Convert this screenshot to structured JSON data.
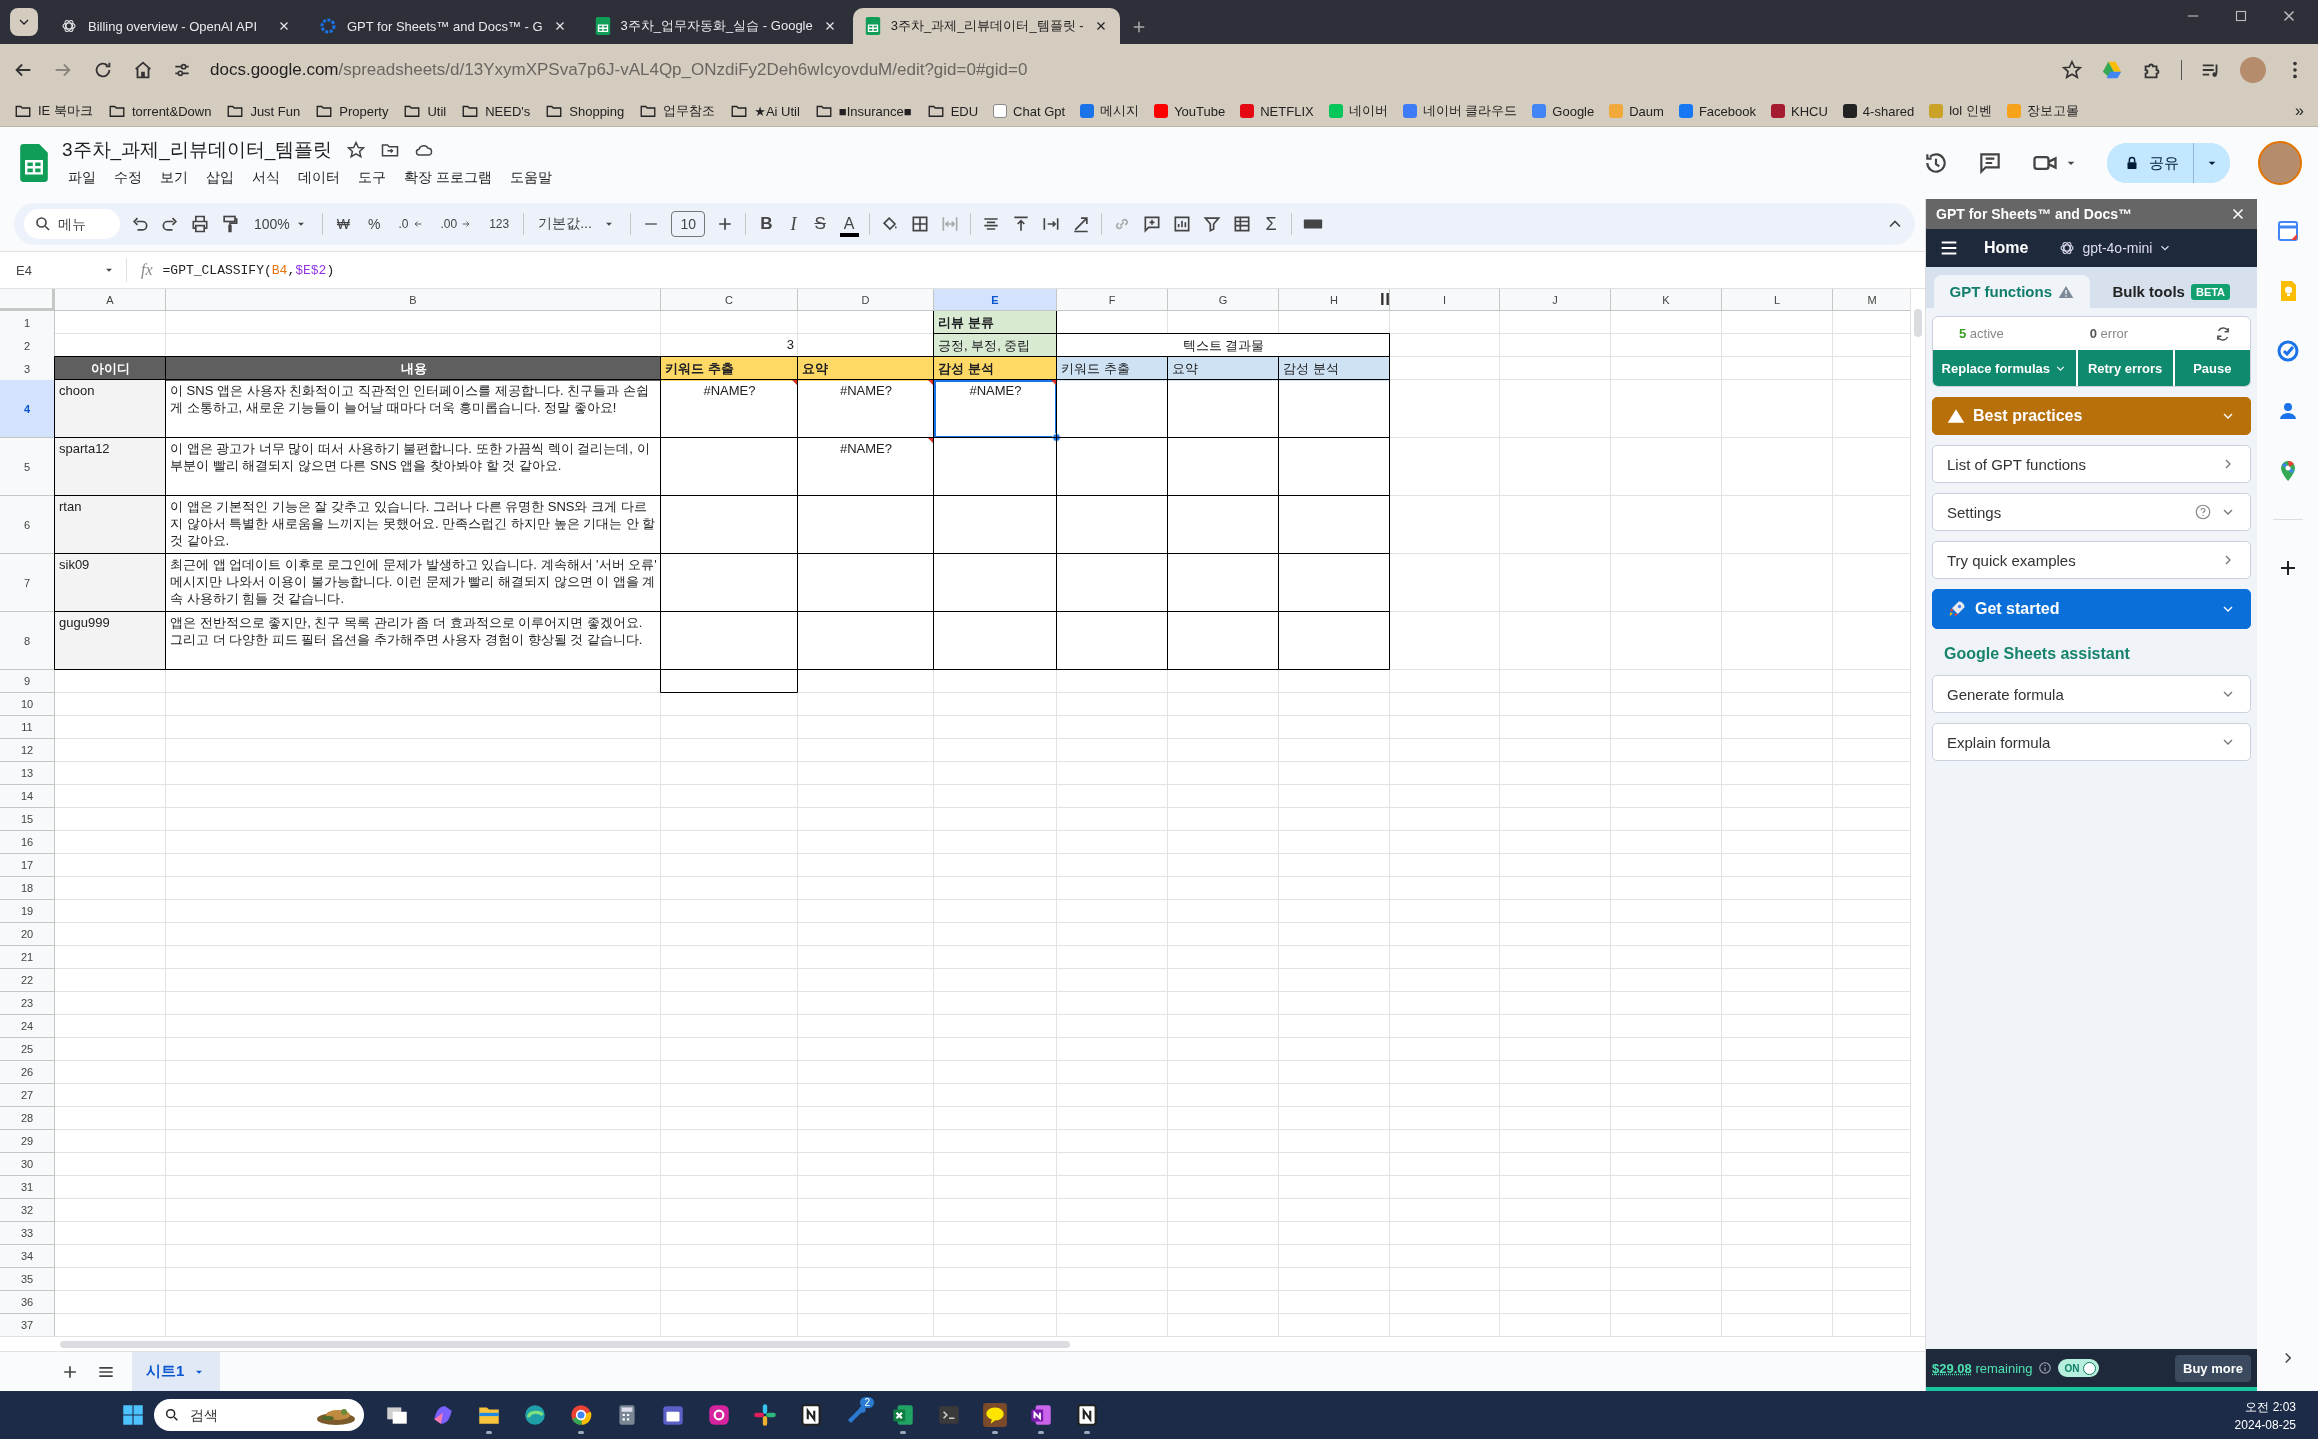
{
  "browser": {
    "tabs": [
      {
        "title": "Billing overview - OpenAI API",
        "kind": "openai",
        "selected": false
      },
      {
        "title": "GPT for Sheets™ and Docs™ - G",
        "kind": "ring",
        "selected": false
      },
      {
        "title": "3주차_업무자동화_실습 - Google",
        "kind": "sheets",
        "selected": false
      },
      {
        "title": "3주차_과제_리뷰데이터_템플릿 -",
        "kind": "sheets",
        "selected": true
      }
    ],
    "address": {
      "domain": "docs.google.com",
      "path": "/spreadsheets/d/13YxymXPSva7p6J-vAL4Qp_ONzdiFy2Deh6wIcyovduM/edit?gid=0#gid=0"
    },
    "bookmarks": [
      {
        "label": "IE 북마크",
        "kind": "folder"
      },
      {
        "label": "torrent&Down",
        "kind": "folder"
      },
      {
        "label": "Just Fun",
        "kind": "folder"
      },
      {
        "label": "Property",
        "kind": "folder"
      },
      {
        "label": "Util",
        "kind": "folder"
      },
      {
        "label": "NEED's",
        "kind": "folder"
      },
      {
        "label": "Shopping",
        "kind": "folder"
      },
      {
        "label": "업무참조",
        "kind": "folder"
      },
      {
        "label": "★Ai Util",
        "kind": "folder"
      },
      {
        "label": "■Insurance■",
        "kind": "folder"
      },
      {
        "label": "EDU",
        "kind": "folder"
      },
      {
        "label": "Chat Gpt",
        "kind": "site",
        "color": "#ffffff"
      },
      {
        "label": "메시지",
        "kind": "site",
        "color": "#1a73e8"
      },
      {
        "label": "YouTube",
        "kind": "site",
        "color": "#ff0000"
      },
      {
        "label": "NETFLIX",
        "kind": "site",
        "color": "#e50914"
      },
      {
        "label": "네이버",
        "kind": "site",
        "color": "#03c75a"
      },
      {
        "label": "네이버 클라우드",
        "kind": "site",
        "color": "#3d7bf7"
      },
      {
        "label": "Google",
        "kind": "site",
        "color": "#4285f4"
      },
      {
        "label": "Daum",
        "kind": "site",
        "color": "#f2a93b"
      },
      {
        "label": "Facebook",
        "kind": "site",
        "color": "#1877f2"
      },
      {
        "label": "KHCU",
        "kind": "site",
        "color": "#a51c30"
      },
      {
        "label": "4-shared",
        "kind": "site",
        "color": "#222222"
      },
      {
        "label": "lol 인벤",
        "kind": "site",
        "color": "#c9a227"
      },
      {
        "label": "장보고몰",
        "kind": "site",
        "color": "#f7a21b"
      }
    ],
    "more_bookmarks": "»"
  },
  "document": {
    "title": "3주차_과제_리뷰데이터_템플릿",
    "menu": [
      "파일",
      "수정",
      "보기",
      "삽입",
      "서식",
      "데이터",
      "도구",
      "확장 프로그램",
      "도움말"
    ],
    "share": "공유"
  },
  "toolbar": {
    "search_placeholder": "메뉴",
    "zoom": "100%",
    "number_formats": [
      {
        "label": "₩",
        "kind": "plain"
      },
      {
        "label": "%",
        "kind": "plain"
      },
      {
        "label": ".0",
        "kind": "decrease"
      },
      {
        "label": ".00",
        "kind": "increase"
      },
      {
        "label": "123",
        "kind": "plain"
      }
    ],
    "font": "기본값...",
    "font_size": "10",
    "text_styles": [
      {
        "label": "B",
        "kind": "bold"
      },
      {
        "label": "I",
        "kind": "italic"
      },
      {
        "label": "S",
        "kind": "strike"
      },
      {
        "label": "A",
        "kind": "color"
      }
    ],
    "functions": "Σ"
  },
  "formula_bar": {
    "name_box": "E4",
    "fx": "fx",
    "formula": [
      {
        "text": "=GPT_CLASSIFY("
      },
      {
        "text": "B4",
        "color": "#e8710a"
      },
      {
        "text": ","
      },
      {
        "text": "$E$2",
        "color": "#9334e6"
      },
      {
        "text": ")"
      }
    ]
  },
  "sheet": {
    "columns": [
      {
        "label": "A",
        "selected": false
      },
      {
        "label": "B",
        "selected": false
      },
      {
        "label": "C",
        "selected": false
      },
      {
        "label": "D",
        "selected": false
      },
      {
        "label": "E",
        "selected": true
      },
      {
        "label": "F",
        "selected": false
      },
      {
        "label": "G",
        "selected": false
      },
      {
        "label": "H",
        "selected": false
      },
      {
        "label": "I",
        "selected": false
      },
      {
        "label": "J",
        "selected": false
      },
      {
        "label": "K",
        "selected": false
      },
      {
        "label": "L",
        "selected": false
      },
      {
        "label": "M",
        "selected": false
      }
    ],
    "rows": [
      {
        "number": "1",
        "selected": false,
        "cells": {
          "E": {
            "text": "리뷰 분류",
            "kind": "group_title"
          }
        }
      },
      {
        "number": "2",
        "selected": false,
        "cells": {
          "C": {
            "text": "3",
            "kind": "number"
          },
          "E": {
            "text": "긍정, 부정, 중립",
            "kind": "label_green"
          },
          "F": {
            "text": "텍스트 결과물",
            "kind": "merged_title"
          }
        }
      },
      {
        "number": "3",
        "selected": false,
        "cells": {
          "A": {
            "text": "아이디",
            "kind": "header_dark"
          },
          "B": {
            "text": "내용",
            "kind": "header_dark"
          },
          "C": {
            "text": "키워드 추출",
            "kind": "header_yellow"
          },
          "D": {
            "text": "요약",
            "kind": "header_yellow"
          },
          "E": {
            "text": "감성 분석",
            "kind": "header_yellow"
          },
          "F": {
            "text": "키워드 추출",
            "kind": "header_blue"
          },
          "G": {
            "text": "요약",
            "kind": "header_blue"
          },
          "H": {
            "text": "감성 분석",
            "kind": "header_blue"
          }
        }
      },
      {
        "number": "4",
        "selected": true,
        "cells": {
          "A": {
            "text": "choon",
            "kind": "id"
          },
          "B": {
            "text": "이 SNS 앱은 사용자 친화적이고 직관적인 인터페이스를 제공합니다. 친구들과 손쉽게 소통하고, 새로운 기능들이 늘어날 때마다 더욱 흥미롭습니다. 정말 좋아요!",
            "kind": "text"
          },
          "C": {
            "text": "#NAME?",
            "kind": "error"
          },
          "D": {
            "text": "#NAME?",
            "kind": "error"
          },
          "E": {
            "text": "#NAME?",
            "kind": "error"
          },
          "F": {
            "kind": "blank"
          },
          "G": {
            "kind": "blank"
          },
          "H": {
            "kind": "blank"
          }
        }
      },
      {
        "number": "5",
        "selected": false,
        "cells": {
          "A": {
            "text": "sparta12",
            "kind": "id"
          },
          "B": {
            "text": "이 앱은 광고가 너무 많이 떠서 사용하기 불편합니다. 또한 가끔씩 렉이 걸리는데, 이 부분이 빨리 해결되지 않으면 다른 SNS 앱을 찾아봐야 할 것 같아요.",
            "kind": "text"
          },
          "C": {
            "kind": "blank"
          },
          "D": {
            "text": "#NAME?",
            "kind": "error"
          },
          "E": {
            "kind": "blank"
          },
          "F": {
            "kind": "blank"
          },
          "G": {
            "kind": "blank"
          },
          "H": {
            "kind": "blank"
          }
        }
      },
      {
        "number": "6",
        "selected": false,
        "cells": {
          "A": {
            "text": "rtan",
            "kind": "id"
          },
          "B": {
            "text": "이 앱은 기본적인 기능은 잘 갖추고 있습니다. 그러나 다른 유명한 SNS와 크게 다르지 않아서 특별한 새로움을 느끼지는 못했어요. 만족스럽긴 하지만 높은 기대는 안 할 것 같아요.",
            "kind": "text"
          },
          "C": {
            "kind": "blank"
          },
          "D": {
            "kind": "blank"
          },
          "E": {
            "kind": "blank"
          },
          "F": {
            "kind": "blank"
          },
          "G": {
            "kind": "blank"
          },
          "H": {
            "kind": "blank"
          }
        }
      },
      {
        "number": "7",
        "selected": false,
        "cells": {
          "A": {
            "text": "sik09",
            "kind": "id"
          },
          "B": {
            "text": "최근에 앱 업데이트 이후로 로그인에 문제가 발생하고 있습니다. 계속해서 '서버 오류' 메시지만 나와서 이용이 불가능합니다. 이런 문제가 빨리 해결되지 않으면 이 앱을 계속 사용하기 힘들 것 같습니다.",
            "kind": "text"
          },
          "C": {
            "kind": "blank"
          },
          "D": {
            "kind": "blank"
          },
          "E": {
            "kind": "blank"
          },
          "F": {
            "kind": "blank"
          },
          "G": {
            "kind": "blank"
          },
          "H": {
            "kind": "blank"
          }
        }
      },
      {
        "number": "8",
        "selected": false,
        "cells": {
          "A": {
            "text": "gugu999",
            "kind": "id"
          },
          "B": {
            "text": "앱은 전반적으로 좋지만, 친구 목록 관리가 좀 더 효과적으로 이루어지면 좋겠어요. 그리고 더 다양한 피드 필터 옵션을 추가해주면 사용자 경험이 향상될 것 같습니다.",
            "kind": "text"
          },
          "C": {
            "kind": "blank"
          },
          "D": {
            "kind": "blank"
          },
          "E": {
            "kind": "blank"
          },
          "F": {
            "kind": "blank"
          },
          "G": {
            "kind": "blank"
          },
          "H": {
            "kind": "blank"
          }
        }
      },
      {
        "number": "9",
        "selected": false,
        "cells": {
          "C": {
            "kind": "blank"
          }
        }
      },
      {
        "number": "10",
        "selected": false
      },
      {
        "number": "11",
        "selected": false
      },
      {
        "number": "12",
        "selected": false
      },
      {
        "number": "13",
        "selected": false
      },
      {
        "number": "14",
        "selected": false
      },
      {
        "number": "15",
        "selected": false
      },
      {
        "number": "16",
        "selected": false
      },
      {
        "number": "17",
        "selected": false
      },
      {
        "number": "18",
        "selected": false
      },
      {
        "number": "19",
        "selected": false
      },
      {
        "number": "20",
        "selected": false
      },
      {
        "number": "21",
        "selected": false
      },
      {
        "number": "22",
        "selected": false
      },
      {
        "number": "23",
        "selected": false
      },
      {
        "number": "24",
        "selected": false
      },
      {
        "number": "25",
        "selected": false
      },
      {
        "number": "26",
        "selected": false
      },
      {
        "number": "27",
        "selected": false
      },
      {
        "number": "28",
        "selected": false
      },
      {
        "number": "29",
        "selected": false
      },
      {
        "number": "30",
        "selected": false
      },
      {
        "number": "31",
        "selected": false
      },
      {
        "number": "32",
        "selected": false
      },
      {
        "number": "33",
        "selected": false
      },
      {
        "number": "34",
        "selected": false
      },
      {
        "number": "35",
        "selected": false
      },
      {
        "number": "36",
        "selected": false
      },
      {
        "number": "37",
        "selected": false
      }
    ],
    "tabs": [
      {
        "label": "시트1",
        "selected": true
      }
    ]
  },
  "side_panel": {
    "title": "GPT for Sheets™ and Docs™",
    "nav": {
      "home": "Home",
      "model": "gpt-4o-mini"
    },
    "tabs": [
      {
        "label": "GPT functions",
        "kind": "warning",
        "selected": true
      },
      {
        "label": "Bulk tools",
        "kind": "beta",
        "badge": "BETA",
        "selected": false
      }
    ],
    "status": {
      "active_count": "5",
      "active_label": "active",
      "error_count": "0",
      "error_label": "error"
    },
    "actions": [
      {
        "label": "Replace formulas",
        "kind": "menu"
      },
      {
        "label": "Retry errors",
        "kind": "plain"
      },
      {
        "label": "Pause",
        "kind": "plain"
      }
    ],
    "sections": [
      {
        "title": "Best practices",
        "kind": "warning"
      },
      {
        "title": "List of GPT functions",
        "kind": "link"
      },
      {
        "title": "Settings",
        "kind": "settings"
      },
      {
        "title": "Try quick examples",
        "kind": "link"
      },
      {
        "title": "Get started",
        "kind": "primary"
      }
    ],
    "assistant": {
      "heading": "Google Sheets assistant",
      "items": [
        {
          "title": "Generate formula"
        },
        {
          "title": "Explain formula"
        }
      ]
    },
    "footer": {
      "amount": "$29.08",
      "label": "remaining",
      "toggle": {
        "label": "ON",
        "on": true
      },
      "button": "Buy more"
    }
  },
  "taskbar": {
    "search_placeholder": "검색",
    "apps": [
      {
        "kind": "taskview",
        "running": false
      },
      {
        "kind": "copilot",
        "running": false
      },
      {
        "kind": "folder",
        "running": true
      },
      {
        "kind": "edge",
        "running": false
      },
      {
        "kind": "chrome",
        "running": true
      },
      {
        "kind": "calculator",
        "running": false
      },
      {
        "kind": "calendar",
        "running": false
      },
      {
        "kind": "instagram",
        "running": false
      },
      {
        "kind": "slack",
        "running": false
      },
      {
        "kind": "notion",
        "running": false
      },
      {
        "kind": "steam",
        "running": false,
        "badge": "2"
      },
      {
        "kind": "excel",
        "running": true
      },
      {
        "kind": "terminal",
        "running": false
      },
      {
        "kind": "chat",
        "running": true
      },
      {
        "kind": "onenote",
        "running": true
      },
      {
        "kind": "notion",
        "running": true
      }
    ],
    "time": "오전 2:03",
    "date": "2024-08-25"
  }
}
